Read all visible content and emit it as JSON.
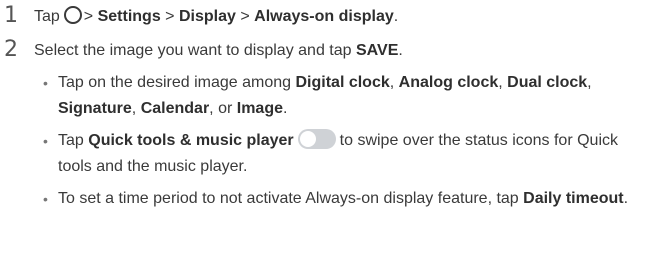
{
  "steps": [
    {
      "number": "1",
      "pre": "Tap",
      "sep1": ">",
      "settings": "Settings",
      "sep2": ">",
      "display": "Display",
      "sep3": ">",
      "always_on": "Always-on display",
      "end": "."
    },
    {
      "number": "2",
      "pre": "Select the image you want to display and tap",
      "save": "SAVE",
      "end": "."
    }
  ],
  "bullets": [
    {
      "pre": "Tap on the desired image among",
      "opt1": "Digital clock",
      "c1": ",",
      "opt2": "Analog clock",
      "c2": ",",
      "opt3": "Dual clock",
      "c3": ",",
      "opt4": "Signature",
      "c4": ",",
      "opt5": "Calendar",
      "or": ", or",
      "opt6": "Image",
      "end": "."
    },
    {
      "pre": "Tap",
      "option": "Quick tools & music player",
      "post": "to swipe over the status icons for Quick tools and the music player."
    },
    {
      "pre": "To set a time period to not activate Always-on display feature, tap",
      "option": "Daily timeout",
      "end": "."
    }
  ],
  "icons": {
    "home": "home-button-icon",
    "toggle": "toggle-switch-icon",
    "toggle_color": "#cfd2d6"
  }
}
